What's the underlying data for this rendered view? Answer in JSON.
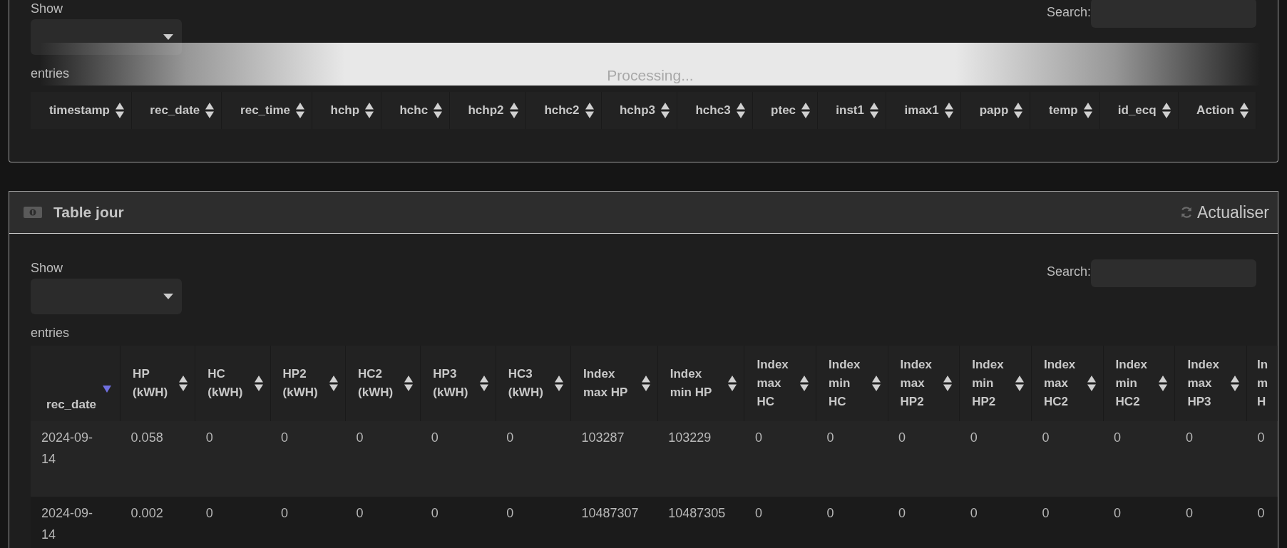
{
  "top_table": {
    "length_label": "Show",
    "entries_label": "entries",
    "search_label": "Search:",
    "processing": "Processing...",
    "columns": [
      {
        "label": "timestamp",
        "sorted": false
      },
      {
        "label": "rec_date",
        "sorted": false
      },
      {
        "label": "rec_time",
        "sorted": false
      },
      {
        "label": "hchp",
        "sorted": false
      },
      {
        "label": "hchc",
        "sorted": false
      },
      {
        "label": "hchp2",
        "sorted": false
      },
      {
        "label": "hchc2",
        "sorted": false
      },
      {
        "label": "hchp3",
        "sorted": false
      },
      {
        "label": "hchc3",
        "sorted": false
      },
      {
        "label": "ptec",
        "sorted": false
      },
      {
        "label": "inst1",
        "sorted": false
      },
      {
        "label": "imax1",
        "sorted": false
      },
      {
        "label": "papp",
        "sorted": false
      },
      {
        "label": "temp",
        "sorted": false
      },
      {
        "label": "id_ecq",
        "sorted": false
      },
      {
        "label": "Action",
        "sorted": false
      }
    ]
  },
  "day_panel": {
    "title": "Table jour",
    "refresh": "Actualiser",
    "length_label": "Show",
    "entries_label": "entries",
    "search_label": "Search:",
    "columns": [
      {
        "label": "rec_date",
        "sorted": true
      },
      {
        "label": "HP (kWH)",
        "sorted": false
      },
      {
        "label": "HC (kWH)",
        "sorted": false
      },
      {
        "label": "HP2 (kWH)",
        "sorted": false
      },
      {
        "label": "HC2 (kWH)",
        "sorted": false
      },
      {
        "label": "HP3 (kWH)",
        "sorted": false
      },
      {
        "label": "HC3 (kWH)",
        "sorted": false
      },
      {
        "label": "Index max HP",
        "sorted": false
      },
      {
        "label": "Index min HP",
        "sorted": false
      },
      {
        "label": "Index max HC",
        "sorted": false
      },
      {
        "label": "Index min HC",
        "sorted": false
      },
      {
        "label": "Index max HP2",
        "sorted": false
      },
      {
        "label": "Index min HP2",
        "sorted": false
      },
      {
        "label": "Index max HC2",
        "sorted": false
      },
      {
        "label": "Index min HC2",
        "sorted": false
      },
      {
        "label": "Index max HP3",
        "sorted": false
      },
      {
        "label": "In m H"
      }
    ],
    "rows": [
      [
        "2024-09-14",
        "0.058",
        "0",
        "0",
        "0",
        "0",
        "0",
        "103287",
        "103229",
        "0",
        "0",
        "0",
        "0",
        "0",
        "0",
        "0",
        "0"
      ],
      [
        "2024-09-14",
        "0.002",
        "0",
        "0",
        "0",
        "0",
        "0",
        "10487307",
        "10487305",
        "0",
        "0",
        "0",
        "0",
        "0",
        "0",
        "0",
        "0"
      ]
    ]
  }
}
